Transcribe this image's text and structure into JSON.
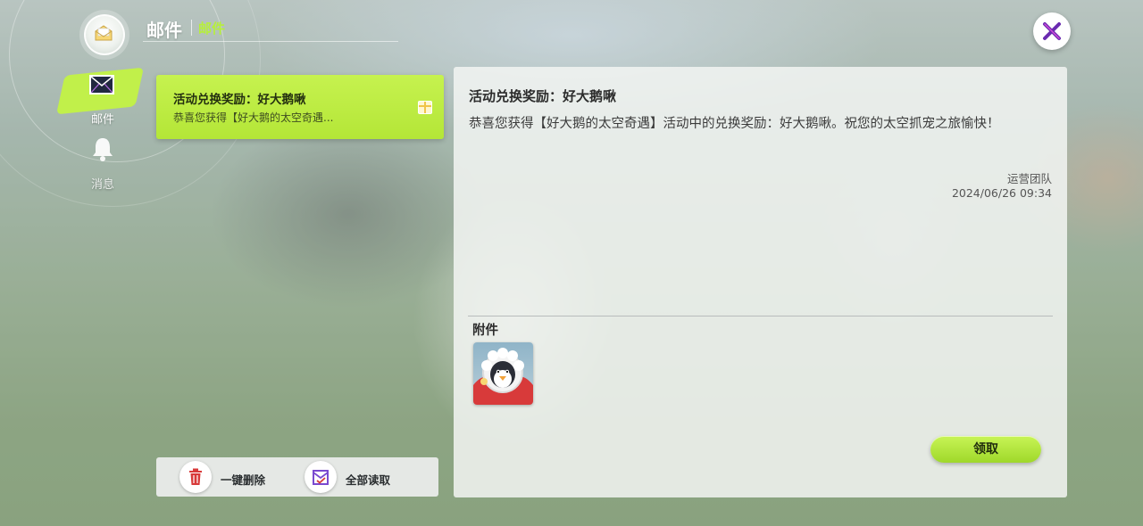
{
  "header": {
    "title": "邮件",
    "subtitle": "邮件",
    "icon": "mail-open-icon"
  },
  "nav": {
    "items": [
      {
        "label": "邮件",
        "icon": "mail-envelope-icon",
        "active": true
      },
      {
        "label": "消息",
        "icon": "bell-icon",
        "active": false
      }
    ]
  },
  "mail_list": {
    "items": [
      {
        "title": "活动兑换奖励：好大鹅啾",
        "preview": "恭喜您获得【好大鹅的太空奇遇...",
        "icon": "gift-icon",
        "selected": true
      }
    ]
  },
  "actions": {
    "delete_all": "一键删除",
    "read_all": "全部读取"
  },
  "detail": {
    "title": "活动兑换奖励：好大鹅啾",
    "body": "恭喜您获得【好大鹅的太空奇遇】活动中的兑换奖励：好大鹅啾。祝您的太空抓宠之旅愉快！",
    "sender": "运营团队",
    "date": "2024/06/26  09:34",
    "attachment_label": "附件",
    "attachments": [
      {
        "icon": "penguin-item-icon"
      }
    ],
    "claim_label": "领取"
  },
  "colors": {
    "accent_green": "#b6ef3c",
    "close_x": "#6a2bb0",
    "delete_icon": "#d83a3a",
    "read_icon": "#7a4ad0"
  }
}
